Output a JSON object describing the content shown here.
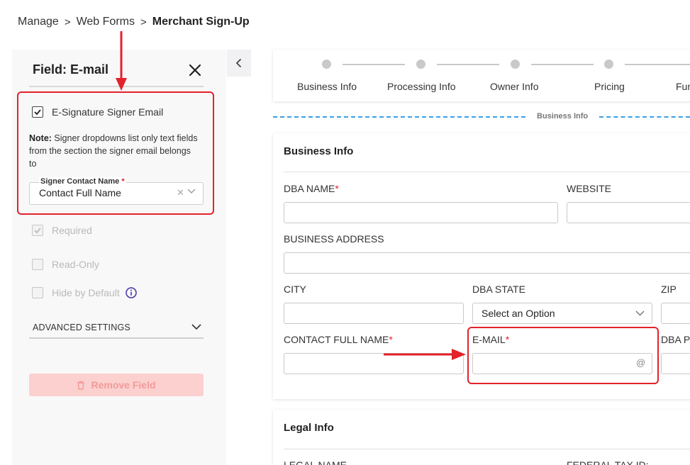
{
  "breadcrumb": {
    "items": [
      "Manage",
      "Web Forms"
    ],
    "current": "Merchant Sign-Up",
    "separator": ">"
  },
  "side_panel": {
    "title": "Field: E-mail",
    "esignature_label": "E-Signature Signer Email",
    "esignature_checked": true,
    "note_bold": "Note:",
    "note_text": " Signer dropdowns list only text fields from the section the signer email belongs to",
    "signer_select": {
      "label": "Signer Contact Name",
      "required_mark": "*",
      "value": "Contact Full Name"
    },
    "required_label": "Required",
    "readonly_label": "Read-Only",
    "hide_label": "Hide by Default",
    "advanced_label": "ADVANCED SETTINGS",
    "remove_label": "Remove Field"
  },
  "steps": [
    "Business Info",
    "Processing Info",
    "Owner Info",
    "Pricing",
    "Fun"
  ],
  "section_divider_label": "Business Info",
  "business_card": {
    "title": "Business Info",
    "fields": {
      "dba_name": "DBA NAME",
      "website": "WEBSITE",
      "business_address": "BUSINESS ADDRESS",
      "city": "CITY",
      "dba_state": "DBA STATE",
      "dba_state_placeholder": "Select an Option",
      "zip": "ZIP",
      "contact_full_name": "CONTACT FULL NAME",
      "email": "E-MAIL",
      "dba_p": "DBA P"
    },
    "required_mark": "*"
  },
  "legal_card": {
    "title": "Legal Info",
    "legal_name": "LEGAL NAME",
    "federal_tax_id": "FEDERAL TAX ID:"
  },
  "colors": {
    "annotation_red": "#e3222b",
    "accent_blue": "#3aa0e6",
    "info_icon": "#4a2fa8"
  },
  "icons": [
    "close-icon",
    "chevron-left-icon",
    "check-icon",
    "chevron-down-icon",
    "clear-icon",
    "info-icon",
    "trash-icon",
    "at-icon",
    "arrow-annotation"
  ]
}
